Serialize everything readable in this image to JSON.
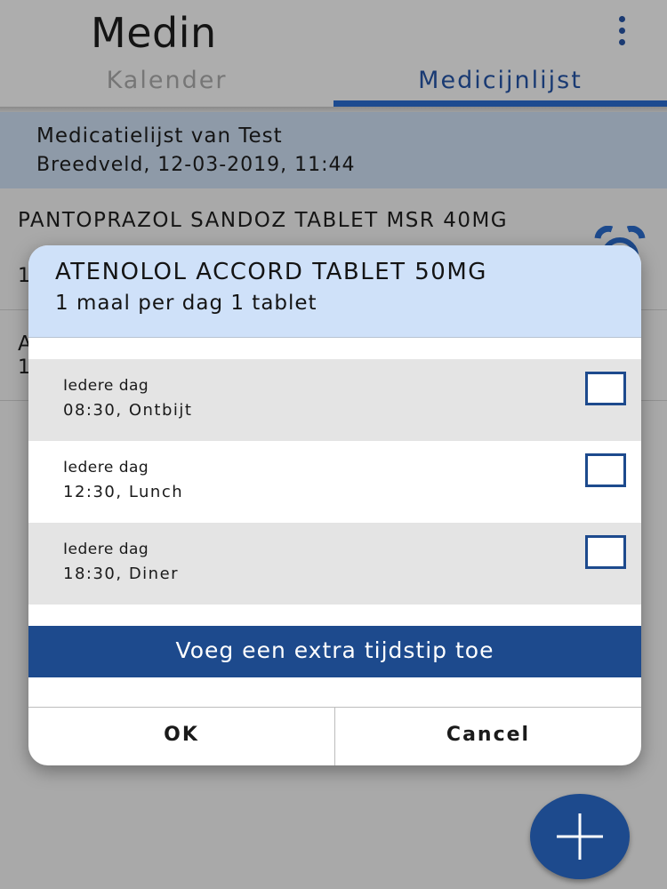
{
  "app": {
    "title": "Medin",
    "menu_icon": "overflow-menu-icon"
  },
  "tabs": [
    {
      "label": "Kalender",
      "selected": false
    },
    {
      "label": "Medicijnlijst",
      "selected": true
    }
  ],
  "list_header": {
    "title": "Medicatielijst van Test",
    "subtitle": "Breedveld, 12-03-2019, 11:44"
  },
  "medications": [
    {
      "name": "PANTOPRAZOL SANDOZ TABLET MSR 40MG",
      "detail": "1",
      "icon": "alarm-clock-icon"
    },
    {
      "name": "A",
      "detail": "1",
      "icon": "alarm-clock-icon"
    }
  ],
  "dialog": {
    "title": "ATENOLOL ACCORD TABLET 50MG",
    "subtitle": "1 maal per dag 1 tablet",
    "schedule": [
      {
        "frequency": "Iedere dag",
        "time": "08:30, Ontbijt",
        "checked": false
      },
      {
        "frequency": "Iedere dag",
        "time": "12:30, Lunch",
        "checked": false
      },
      {
        "frequency": "Iedere dag",
        "time": "18:30, Diner",
        "checked": false
      }
    ],
    "add_time_label": "Voeg een extra tijdstip toe",
    "ok_label": "OK",
    "cancel_label": "Cancel"
  },
  "fab": {
    "icon": "plus-icon"
  },
  "colors": {
    "primary": "#1d4a8d",
    "tab_active": "#193a73",
    "dialog_header": "#cfe1f9",
    "list_header": "#8e9aa8",
    "row_shaded": "#e4e4e4"
  }
}
